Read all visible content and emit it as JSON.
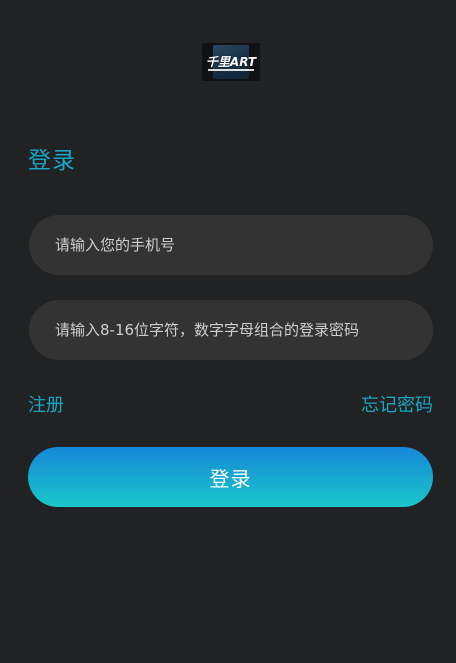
{
  "logo": {
    "text": "千里ART"
  },
  "page": {
    "title": "登录"
  },
  "form": {
    "phone": {
      "value": "",
      "placeholder": "请输入您的手机号"
    },
    "password": {
      "value": "",
      "placeholder": "请输入8-16位字符，数字字母组合的登录密码"
    },
    "register_label": "注册",
    "forgot_label": "忘记密码",
    "submit_label": "登录"
  },
  "colors": {
    "background": "#202223",
    "accent": "#1aa6c3",
    "field_background": "#333333",
    "button_gradient_top": "#1587d8",
    "button_gradient_bottom": "#1ac7c9"
  }
}
